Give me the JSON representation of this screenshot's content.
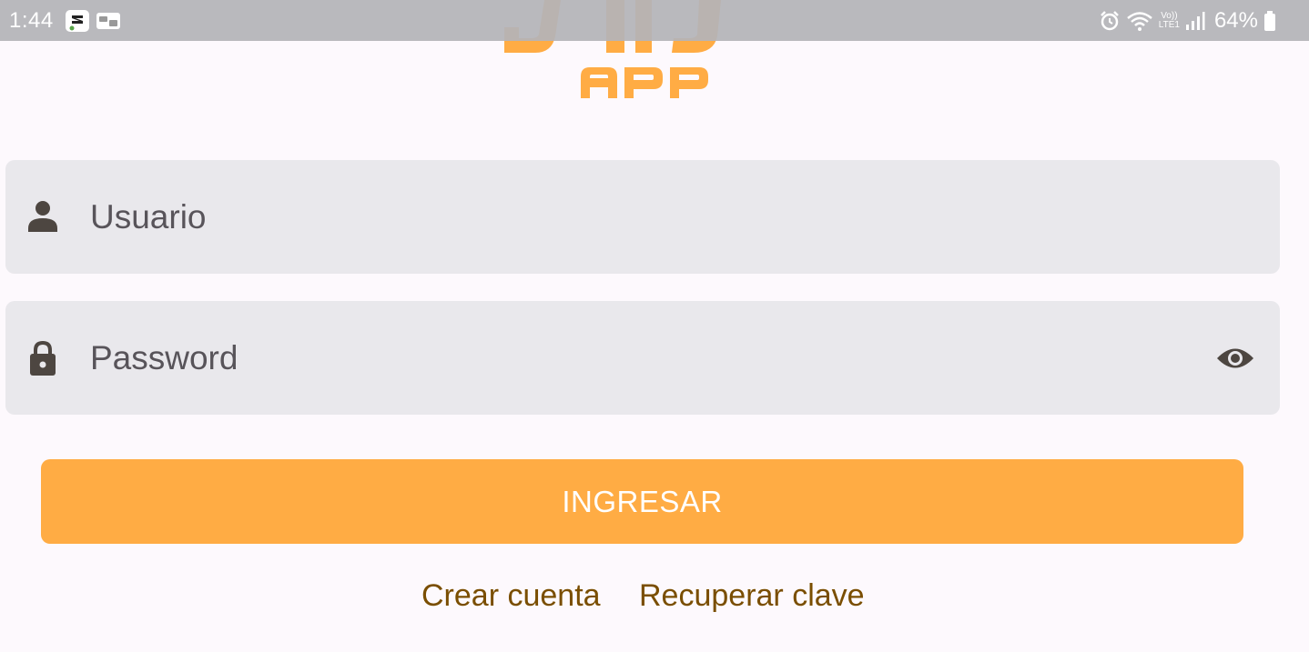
{
  "status_bar": {
    "time": "1:44",
    "battery_percent": "64%",
    "network_label_top": "Vo))",
    "network_label_bottom": "LTE1",
    "left_icons": [
      "notification-app-icon",
      "notification-card-icon"
    ],
    "right_icons": [
      "alarm-icon",
      "wifi-icon",
      "signal-icon",
      "battery-icon"
    ]
  },
  "logo": {
    "text": "APP",
    "color": "#ffac44"
  },
  "form": {
    "username": {
      "placeholder": "Usuario",
      "value": "",
      "icon": "person-icon"
    },
    "password": {
      "placeholder": "Password",
      "value": "",
      "icon": "lock-icon",
      "toggle_icon": "eye-icon"
    }
  },
  "actions": {
    "login_label": "INGRESAR",
    "create_account_label": "Crear cuenta",
    "recover_password_label": "Recuperar clave"
  },
  "colors": {
    "accent": "#ffac44",
    "link": "#7a4e00",
    "field_bg": "#e9e8ec",
    "icon": "#4d4641"
  }
}
